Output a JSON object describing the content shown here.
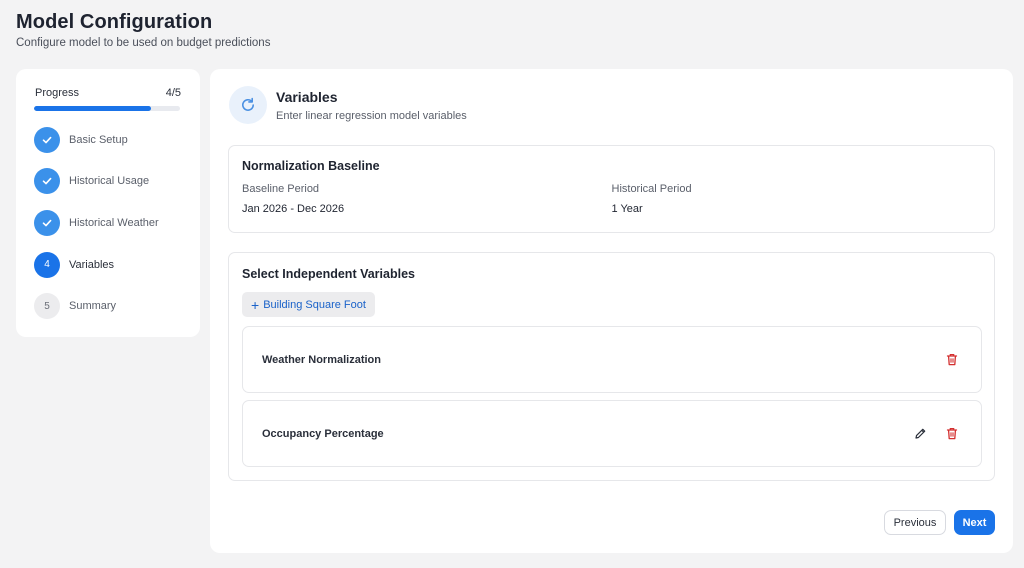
{
  "header": {
    "title": "Model Configuration",
    "subtitle": "Configure model to be used on budget predictions"
  },
  "progress": {
    "label": "Progress",
    "count": "4/5",
    "fraction": 0.8
  },
  "steps": [
    {
      "label": "Basic Setup",
      "number": "1",
      "state": "done"
    },
    {
      "label": "Historical Usage",
      "number": "2",
      "state": "done"
    },
    {
      "label": "Historical Weather",
      "number": "3",
      "state": "done"
    },
    {
      "label": "Variables",
      "number": "4",
      "state": "active"
    },
    {
      "label": "Summary",
      "number": "5",
      "state": "pending"
    }
  ],
  "section": {
    "icon": "refresh-icon",
    "title": "Variables",
    "subtitle": "Enter linear regression model variables"
  },
  "normalization": {
    "title": "Normalization Baseline",
    "baseline_label": "Baseline Period",
    "baseline_value": "Jan 2026 - Dec 2026",
    "historical_label": "Historical Period",
    "historical_value": "1 Year"
  },
  "variables": {
    "title": "Select Independent Variables",
    "add_label": "Building Square Foot",
    "items": [
      {
        "name": "Weather Normalization",
        "editable": false
      },
      {
        "name": "Occupancy Percentage",
        "editable": true
      }
    ]
  },
  "footer": {
    "previous_label": "Previous",
    "next_label": "Next"
  },
  "colors": {
    "accent": "#1a73e8",
    "done": "#3b91ea",
    "danger": "#d32f2f"
  }
}
